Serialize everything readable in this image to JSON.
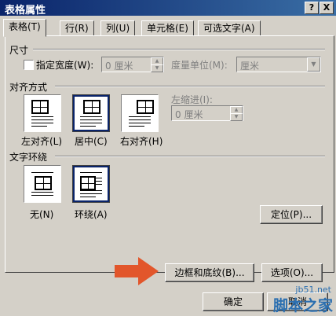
{
  "window": {
    "title": "表格属性",
    "help_label": "?",
    "close_label": "X"
  },
  "tabs": [
    {
      "label": "表格(T)"
    },
    {
      "label": "行(R)"
    },
    {
      "label": "列(U)"
    },
    {
      "label": "单元格(E)"
    },
    {
      "label": "可选文字(A)"
    }
  ],
  "size": {
    "section": "尺寸",
    "specify_width_label": "指定宽度(W):",
    "width_value": "0 厘米",
    "unit_label": "度量单位(M):",
    "unit_value": "厘米"
  },
  "alignment": {
    "section": "对齐方式",
    "options": [
      {
        "label": "左对齐(L)"
      },
      {
        "label": "居中(C)"
      },
      {
        "label": "右对齐(H)"
      }
    ],
    "indent_label": "左缩进(I):",
    "indent_value": "0 厘米"
  },
  "wrapping": {
    "section": "文字环绕",
    "options": [
      {
        "label": "无(N)"
      },
      {
        "label": "环绕(A)"
      }
    ],
    "position_button": "定位(P)..."
  },
  "buttons": {
    "borders": "边框和底纹(B)...",
    "options": "选项(O)...",
    "ok": "确定",
    "cancel": "取消"
  },
  "watermark": {
    "line1": "jb51.net",
    "line2": "脚本之家"
  },
  "colors": {
    "title_bar": "#0a246a",
    "arrow": "#e2562b",
    "watermark": "#2b6fb0"
  }
}
